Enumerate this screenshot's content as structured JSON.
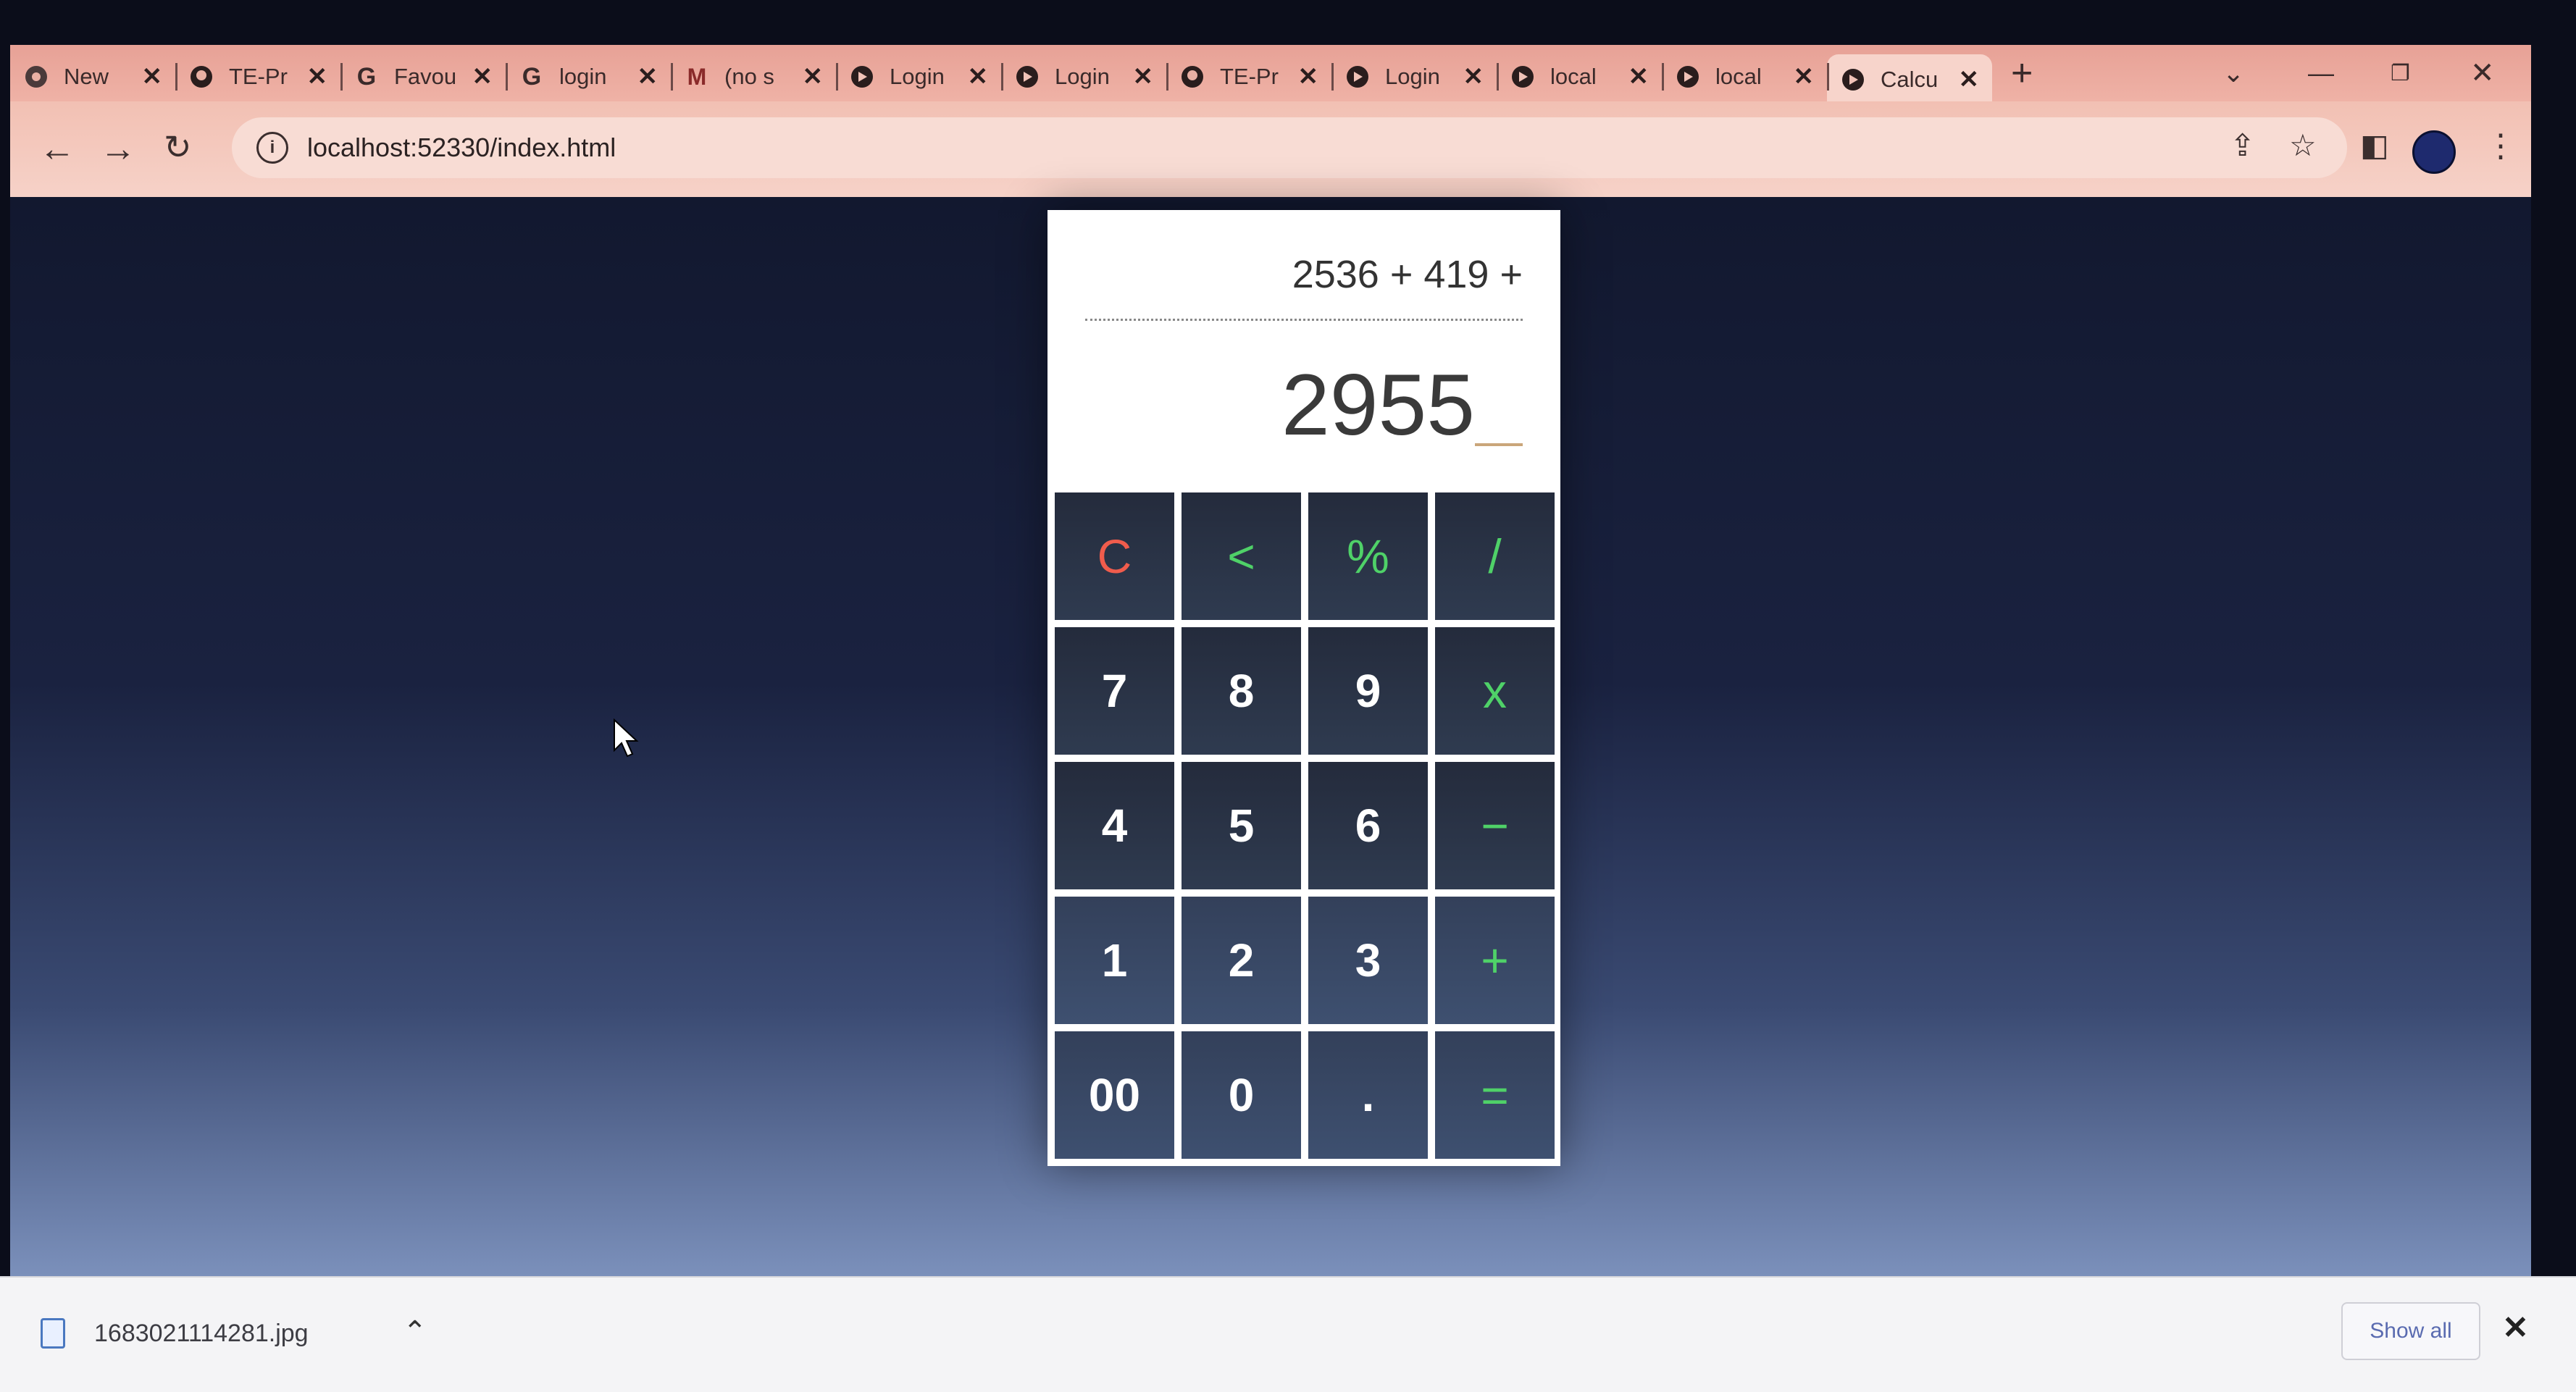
{
  "tabs": [
    {
      "label": "New",
      "icon": "chrome-icon",
      "active": false
    },
    {
      "label": "TE-Pr",
      "icon": "github-icon",
      "active": false
    },
    {
      "label": "Favou",
      "icon": "google-icon",
      "active": false
    },
    {
      "label": "login",
      "icon": "google-icon",
      "active": false
    },
    {
      "label": "(no s",
      "icon": "gmail-icon",
      "active": false
    },
    {
      "label": "Login",
      "icon": "site-icon",
      "active": false
    },
    {
      "label": "Login",
      "icon": "site-icon",
      "active": false
    },
    {
      "label": "TE-Pr",
      "icon": "github-icon",
      "active": false
    },
    {
      "label": "Login",
      "icon": "site-icon",
      "active": false
    },
    {
      "label": "local",
      "icon": "site-icon",
      "active": false
    },
    {
      "label": "local",
      "icon": "site-icon",
      "active": false
    },
    {
      "label": "Calcu",
      "icon": "site-icon",
      "active": true
    }
  ],
  "toolbar": {
    "url": "localhost:52330/index.html"
  },
  "calculator": {
    "expression": "2536 + 419 +",
    "result": "2955",
    "keys": [
      "C",
      "<",
      "%",
      "/",
      "7",
      "8",
      "9",
      "x",
      "4",
      "5",
      "6",
      "−",
      "1",
      "2",
      "3",
      "+",
      "00",
      "0",
      ".",
      "="
    ],
    "colors": {
      "operator": "#4fd168",
      "clear": "#f05c4c",
      "key_bg": "#2a3346"
    }
  },
  "download_bar": {
    "file_name": "1683021114281.jpg",
    "show_all_label": "Show all"
  }
}
